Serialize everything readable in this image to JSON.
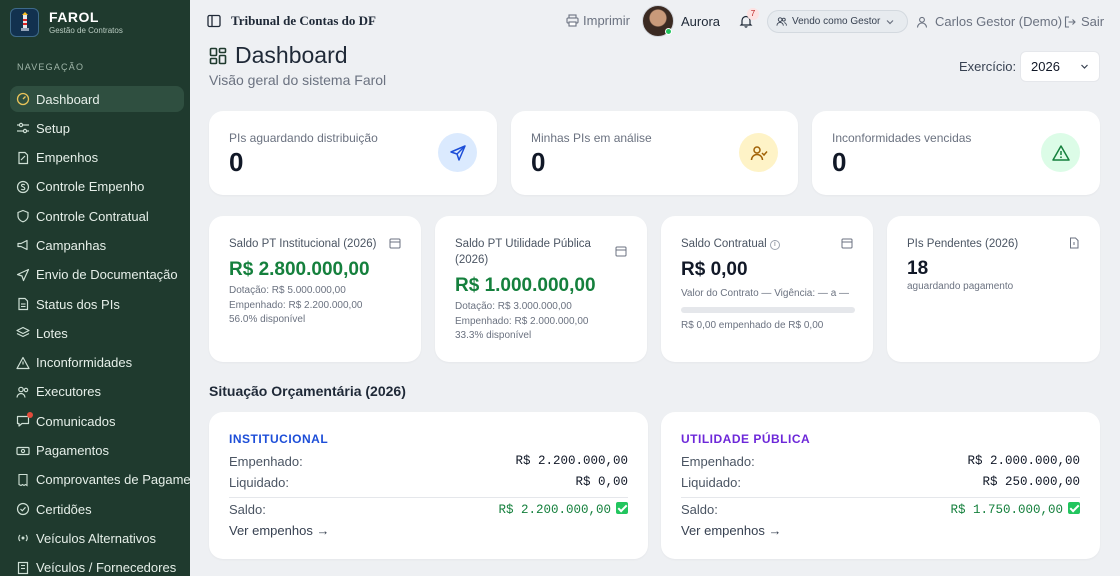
{
  "brand": {
    "name": "FAROL",
    "tagline": "Gestão de Contratos"
  },
  "sidebar": {
    "section": "NAVEGAÇÃO",
    "items": [
      {
        "label": "Dashboard",
        "icon": "gauge-icon",
        "active": true
      },
      {
        "label": "Setup",
        "icon": "sliders-icon"
      },
      {
        "label": "Empenhos",
        "icon": "file-edit-icon"
      },
      {
        "label": "Controle Empenho",
        "icon": "dollar-circle-icon"
      },
      {
        "label": "Controle Contratual",
        "icon": "shield-icon"
      },
      {
        "label": "Campanhas",
        "icon": "megaphone-icon"
      },
      {
        "label": "Envio de Documentação",
        "icon": "send-icon"
      },
      {
        "label": "Status dos PIs",
        "icon": "document-icon"
      },
      {
        "label": "Lotes",
        "icon": "layers-icon"
      },
      {
        "label": "Inconformidades",
        "icon": "warning-icon"
      },
      {
        "label": "Executores",
        "icon": "users-icon"
      },
      {
        "label": "Comunicados",
        "icon": "chat-icon",
        "notification": true
      },
      {
        "label": "Pagamentos",
        "icon": "banknote-icon"
      },
      {
        "label": "Comprovantes de Pagamento",
        "icon": "receipt-icon"
      },
      {
        "label": "Certidões",
        "icon": "badge-check-icon"
      },
      {
        "label": "Veículos Alternativos",
        "icon": "radio-icon"
      },
      {
        "label": "Veículos / Fornecedores",
        "icon": "building-icon"
      }
    ]
  },
  "topbar": {
    "title": "Tribunal de Contas do DF",
    "print": "Imprimir",
    "assistant": "Aurora",
    "notifications": "7",
    "role": "Vendo como Gestor",
    "user": "Carlos Gestor (Demo)",
    "logout": "Sair"
  },
  "page": {
    "title": "Dashboard",
    "subtitle": "Visão geral do sistema Farol",
    "exercise_label": "Exercício:",
    "exercise_value": "2026"
  },
  "stats": [
    {
      "label": "PIs aguardando distribuição",
      "value": "0",
      "icon": "send-icon",
      "color": "#dbeafe"
    },
    {
      "label": "Minhas PIs em análise",
      "value": "0",
      "icon": "user-check-icon",
      "color": "#fef3c7"
    },
    {
      "label": "Inconformidades vencidas",
      "value": "0",
      "icon": "alert-triangle-icon",
      "color": "#dcfce7"
    }
  ],
  "balances": {
    "institucional": {
      "label": "Saldo PT Institucional (2026)",
      "value": "R$ 2.800.000,00",
      "line1": "Dotação: R$ 5.000.000,00",
      "line2": "Empenhado: R$ 2.200.000,00",
      "line3": "56.0% disponível"
    },
    "utilidade": {
      "label": "Saldo PT Utilidade Pública (2026)",
      "value": "R$ 1.000.000,00",
      "line1": "Dotação: R$ 3.000.000,00",
      "line2": "Empenhado: R$ 2.000.000,00",
      "line3": "33.3% disponível"
    },
    "contratual": {
      "label": "Saldo Contratual",
      "value": "R$ 0,00",
      "line1": "Valor do Contrato — Vigência: — a —",
      "progress": 0,
      "line2": "R$ 0,00 empenhado de R$ 0,00"
    },
    "pendentes": {
      "label": "PIs Pendentes (2026)",
      "value": "18",
      "line1": "aguardando pagamento"
    }
  },
  "budget": {
    "section_title": "Situação Orçamentária (2026)",
    "cards": [
      {
        "title": "INSTITUCIONAL",
        "title_color": "#1d4ed8",
        "empenhado_label": "Empenhado:",
        "empenhado": "R$ 2.200.000,00",
        "liquidado_label": "Liquidado:",
        "liquidado": "R$ 0,00",
        "saldo_label": "Saldo:",
        "saldo": "R$ 2.200.000,00",
        "link": "Ver empenhos →"
      },
      {
        "title": "UTILIDADE PÚBLICA",
        "title_color": "#6d28d9",
        "empenhado_label": "Empenhado:",
        "empenhado": "R$ 2.000.000,00",
        "liquidado_label": "Liquidado:",
        "liquidado": "R$ 250.000,00",
        "saldo_label": "Saldo:",
        "saldo": "R$ 1.750.000,00",
        "link": "Ver empenhos →"
      }
    ]
  },
  "colors": {
    "sidebar": "#1f3a2e",
    "accent_green": "#15803d"
  }
}
